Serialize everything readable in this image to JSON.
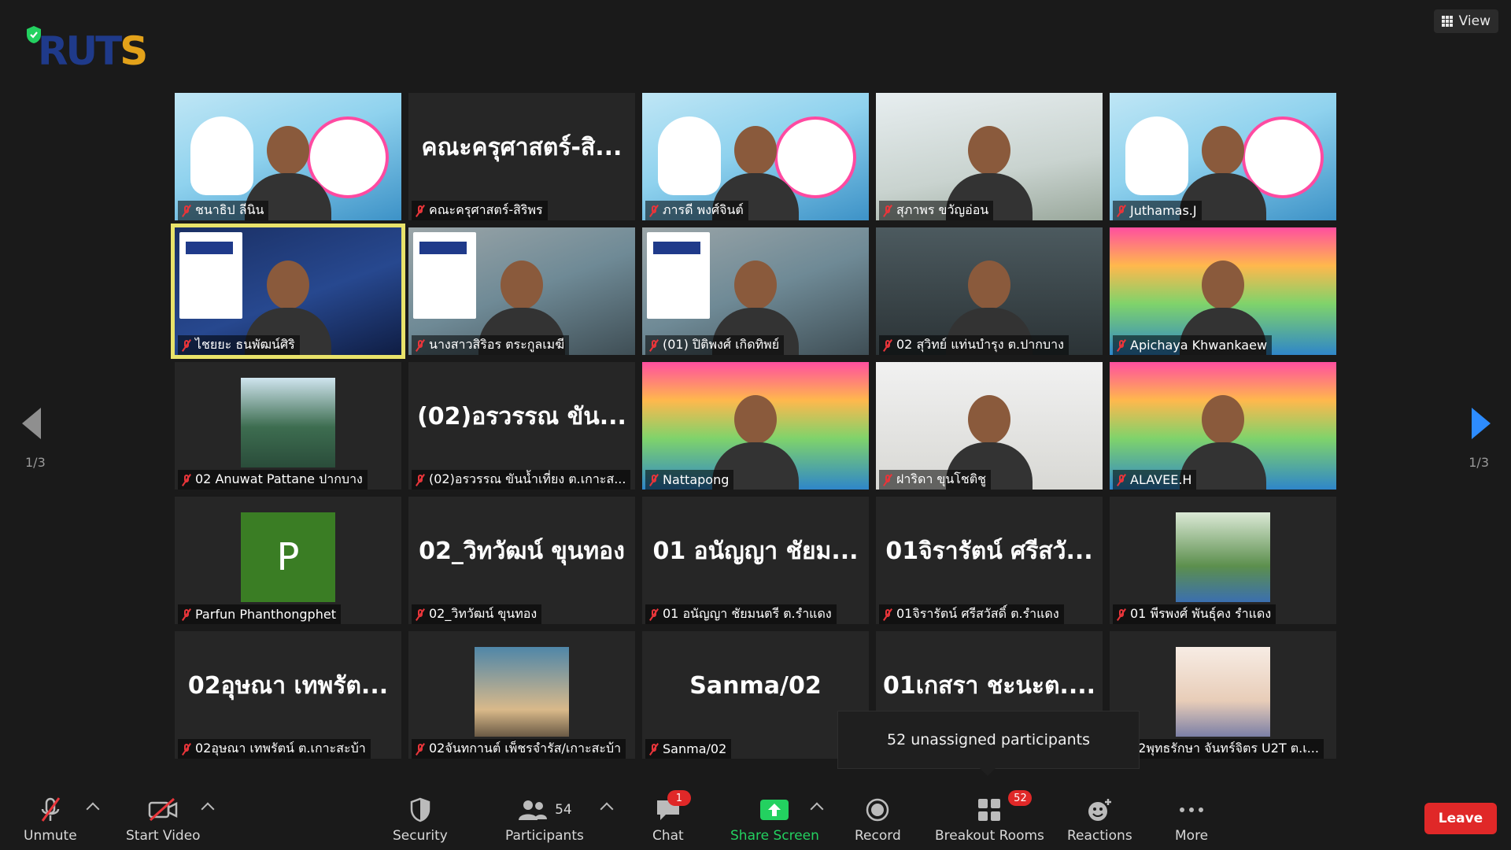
{
  "header": {
    "logo_text_r": "RUT",
    "logo_text_s": "S",
    "view_label": "View"
  },
  "pager": {
    "left": "1/3",
    "right": "1/3"
  },
  "tiles": [
    {
      "name": "ชนาธิป ลีนิน",
      "big": "",
      "style": "video-a"
    },
    {
      "name": "คณะครุศาสตร์-สิริพร",
      "big": "คณะครุศาสตร์-สิ...",
      "style": ""
    },
    {
      "name": "ภารดี พงศ์จินต์",
      "big": "",
      "style": "video-a"
    },
    {
      "name": "สุภาพร ขวัญอ่อน",
      "big": "",
      "style": "video-b"
    },
    {
      "name": "Juthamas.J",
      "big": "",
      "style": "video-a"
    },
    {
      "name": "ไชยยะ ธนพัฒน์ศิริ",
      "big": "",
      "style": "video-d",
      "active": true
    },
    {
      "name": "นางสาวสิริอร ตระกูลเมฆี",
      "big": "",
      "style": "video-e"
    },
    {
      "name": "(01) ปิติพงศ์ เกิดทิพย์",
      "big": "",
      "style": "video-e"
    },
    {
      "name": "02 สุวิทย์ แท่นบำรุง ต.ปากบาง",
      "big": "",
      "style": "video-f"
    },
    {
      "name": "Apichaya Khwankaew",
      "big": "",
      "style": "video-g"
    },
    {
      "name": "02 Anuwat Pattane ปากบาง",
      "big": "",
      "style": "",
      "photo": "land"
    },
    {
      "name": "(02)อรวรรณ ขันน้ำเที่ยง ต.เกาะส...",
      "big": "(02)อรวรรณ ขัน...",
      "style": ""
    },
    {
      "name": "Nattapong",
      "big": "",
      "style": "video-g"
    },
    {
      "name": "ฝาริดา ขุนโชติชู",
      "big": "",
      "style": "video-h"
    },
    {
      "name": "ALAVEE.H",
      "big": "",
      "style": "video-g"
    },
    {
      "name": "Parfun Phanthongphet",
      "big": "",
      "style": "",
      "avatar": "P"
    },
    {
      "name": "02_วิทวัฒน์ ขุนทอง",
      "big": "02_วิทวัฒน์ ขุนทอง",
      "style": ""
    },
    {
      "name": "01 อนัญญา ชัยมนตรี ต.รำแดง",
      "big": "01 อนัญญา ชัยม...",
      "style": ""
    },
    {
      "name": "01จิรารัตน์ ศรีสวัสดิ์ ต.รำแดง",
      "big": "01จิรารัตน์ ศรีสวั...",
      "style": ""
    },
    {
      "name": "01 พีรพงศ์ พันธุ์คง รำแดง",
      "big": "",
      "style": "",
      "photo": "garden"
    },
    {
      "name": "02อุษณา เทพรัตน์ ต.เกาะสะบ้า",
      "big": "02อุษณา เทพรัต...",
      "style": ""
    },
    {
      "name": "02จันทกานต์ เพ็ชรจำรัส/เกาะสะบ้า",
      "big": "",
      "style": "",
      "photo": "beach"
    },
    {
      "name": "Sanma/02",
      "big": "Sanma/02",
      "style": ""
    },
    {
      "name": "",
      "big": "01เกสรา ชะนะต....",
      "style": ""
    },
    {
      "name": "02พุทธรักษา จันทร์จิตร U2T  ต.เ...",
      "big": "",
      "style": "",
      "photo": "woman"
    }
  ],
  "tooltip": "52 unassigned participants",
  "toolbar": {
    "unmute": "Unmute",
    "start_video": "Start Video",
    "security": "Security",
    "participants": "Participants",
    "participants_count": "54",
    "chat": "Chat",
    "chat_badge": "1",
    "share_screen": "Share Screen",
    "record": "Record",
    "breakout_rooms": "Breakout Rooms",
    "breakout_badge": "52",
    "reactions": "Reactions",
    "more": "More",
    "leave": "Leave"
  },
  "colors": {
    "accent_blue": "#2d8cff",
    "share_green": "#23d160",
    "leave_red": "#e02828",
    "active_speaker": "#e9e36a"
  }
}
